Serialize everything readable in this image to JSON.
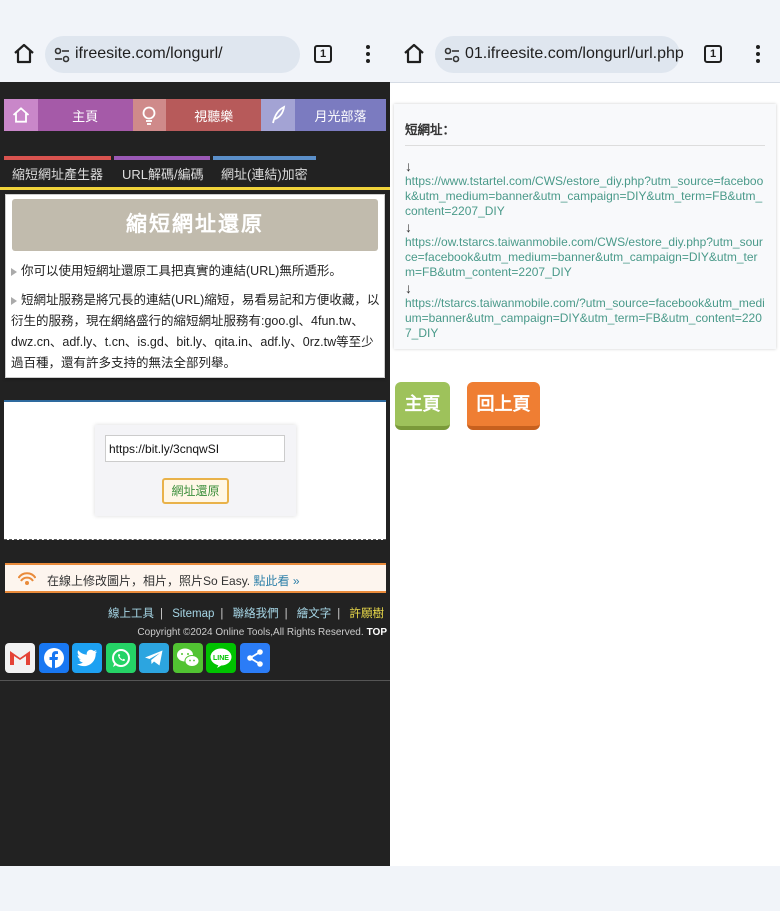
{
  "left": {
    "browser": {
      "url": "ifreesite.com/longurl/",
      "tab_count": "1"
    },
    "top_nav": {
      "items": [
        {
          "label": "主頁",
          "color": "#a55aa8",
          "icon_bg": "#c987c9",
          "icon": "home-icon"
        },
        {
          "label": "視聽樂",
          "color": "#b75a5a",
          "icon_bg": "#cf8a8a",
          "icon": "bulb-icon"
        },
        {
          "label": "月光部落",
          "color": "#7b7bc0",
          "icon_bg": "#a3a3d4",
          "icon": "feather-icon"
        }
      ]
    },
    "sub_nav": [
      {
        "label": "縮短網址產生器",
        "color": "#d9534f"
      },
      {
        "label": "URL解碼/編碼",
        "color": "#9b59b6"
      },
      {
        "label": "網址(連結)加密",
        "color": "#5b8fc9"
      }
    ],
    "card": {
      "title": "縮短網址還原",
      "p1": "你可以使用短網址還原工具把真實的連結(URL)無所遁形。",
      "p2": "短網址服務是將冗長的連結(URL)縮短，易看易記和方便收藏，以衍生的服務，現在網絡盛行的縮短網址服務有:goo.gl、4fun.tw、dwz.cn、adf.ly、t.cn、is.gd、bit.ly、qita.in、adf.ly、0rz.tw等至少過百種，還有許多支持的無法全部列舉。"
    },
    "form": {
      "input_value": "https://bit.ly/3cnqwSI",
      "button_label": "網址還原"
    },
    "promo": {
      "text": "在線上修改圖片，相片，照片So Easy.",
      "link": "點此看 »"
    },
    "footer": {
      "links": [
        "線上工具",
        "Sitemap",
        "聯絡我們",
        "繪文字",
        "許願樹"
      ],
      "sep": "|",
      "copyright": "Copyright ©2024 Online Tools,All Rights Reserved.",
      "top": "TOP"
    },
    "share": [
      {
        "icon": "gmail-icon",
        "color": "#e44336"
      },
      {
        "icon": "facebook-icon",
        "color": "#1877f2"
      },
      {
        "icon": "twitter-icon",
        "color": "#1da1f2"
      },
      {
        "icon": "whatsapp-icon",
        "color": "#25d366"
      },
      {
        "icon": "telegram-icon",
        "color": "#2ca5e0"
      },
      {
        "icon": "wechat-icon",
        "color": "#51c332"
      },
      {
        "icon": "line-icon",
        "color": "#00c300"
      },
      {
        "icon": "share-icon",
        "color": "#2b7cf6"
      }
    ]
  },
  "right": {
    "browser": {
      "url": "01.ifreesite.com/longurl/url.php",
      "tab_count": "1"
    },
    "result": {
      "label": "短網址：",
      "arrow": "↓",
      "links": [
        "https://www.tstartel.com/CWS/estore_diy.php?utm_source=facebook&utm_medium=banner&utm_campaign=DIY&utm_term=FB&utm_content=2207_DIY",
        "https://ow.tstarcs.taiwanmobile.com/CWS/estore_diy.php?utm_source=facebook&utm_medium=banner&utm_campaign=DIY&utm_term=FB&utm_content=2207_DIY",
        "https://tstarcs.taiwanmobile.com/?utm_source=facebook&utm_medium=banner&utm_campaign=DIY&utm_term=FB&utm_content=2207_DIY"
      ]
    },
    "buttons": {
      "home": "主頁",
      "back": "回上頁"
    }
  }
}
